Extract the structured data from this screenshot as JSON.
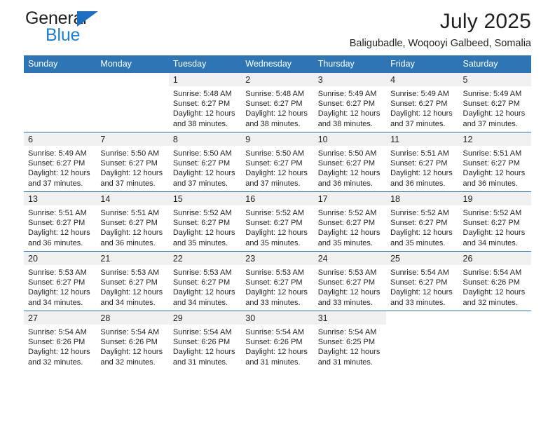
{
  "brand": {
    "name_part1": "General",
    "name_part2": "Blue",
    "triangle_color": "#1b6ec2",
    "blue_color": "#1b7fd4"
  },
  "header": {
    "title": "July 2025",
    "subtitle": "Baligubadle, Woqooyi Galbeed, Somalia",
    "header_bg": "#2e75b6",
    "daynum_bg": "#f0f0f0"
  },
  "weekdays": [
    "Sunday",
    "Monday",
    "Tuesday",
    "Wednesday",
    "Thursday",
    "Friday",
    "Saturday"
  ],
  "weeks": [
    [
      {
        "day": "",
        "blank": true,
        "lines": []
      },
      {
        "day": "",
        "blank": true,
        "lines": []
      },
      {
        "day": "1",
        "lines": [
          "Sunrise: 5:48 AM",
          "Sunset: 6:27 PM",
          "Daylight: 12 hours",
          "and 38 minutes."
        ]
      },
      {
        "day": "2",
        "lines": [
          "Sunrise: 5:48 AM",
          "Sunset: 6:27 PM",
          "Daylight: 12 hours",
          "and 38 minutes."
        ]
      },
      {
        "day": "3",
        "lines": [
          "Sunrise: 5:49 AM",
          "Sunset: 6:27 PM",
          "Daylight: 12 hours",
          "and 38 minutes."
        ]
      },
      {
        "day": "4",
        "lines": [
          "Sunrise: 5:49 AM",
          "Sunset: 6:27 PM",
          "Daylight: 12 hours",
          "and 37 minutes."
        ]
      },
      {
        "day": "5",
        "lines": [
          "Sunrise: 5:49 AM",
          "Sunset: 6:27 PM",
          "Daylight: 12 hours",
          "and 37 minutes."
        ]
      }
    ],
    [
      {
        "day": "6",
        "lines": [
          "Sunrise: 5:49 AM",
          "Sunset: 6:27 PM",
          "Daylight: 12 hours",
          "and 37 minutes."
        ]
      },
      {
        "day": "7",
        "lines": [
          "Sunrise: 5:50 AM",
          "Sunset: 6:27 PM",
          "Daylight: 12 hours",
          "and 37 minutes."
        ]
      },
      {
        "day": "8",
        "lines": [
          "Sunrise: 5:50 AM",
          "Sunset: 6:27 PM",
          "Daylight: 12 hours",
          "and 37 minutes."
        ]
      },
      {
        "day": "9",
        "lines": [
          "Sunrise: 5:50 AM",
          "Sunset: 6:27 PM",
          "Daylight: 12 hours",
          "and 37 minutes."
        ]
      },
      {
        "day": "10",
        "lines": [
          "Sunrise: 5:50 AM",
          "Sunset: 6:27 PM",
          "Daylight: 12 hours",
          "and 36 minutes."
        ]
      },
      {
        "day": "11",
        "lines": [
          "Sunrise: 5:51 AM",
          "Sunset: 6:27 PM",
          "Daylight: 12 hours",
          "and 36 minutes."
        ]
      },
      {
        "day": "12",
        "lines": [
          "Sunrise: 5:51 AM",
          "Sunset: 6:27 PM",
          "Daylight: 12 hours",
          "and 36 minutes."
        ]
      }
    ],
    [
      {
        "day": "13",
        "lines": [
          "Sunrise: 5:51 AM",
          "Sunset: 6:27 PM",
          "Daylight: 12 hours",
          "and 36 minutes."
        ]
      },
      {
        "day": "14",
        "lines": [
          "Sunrise: 5:51 AM",
          "Sunset: 6:27 PM",
          "Daylight: 12 hours",
          "and 36 minutes."
        ]
      },
      {
        "day": "15",
        "lines": [
          "Sunrise: 5:52 AM",
          "Sunset: 6:27 PM",
          "Daylight: 12 hours",
          "and 35 minutes."
        ]
      },
      {
        "day": "16",
        "lines": [
          "Sunrise: 5:52 AM",
          "Sunset: 6:27 PM",
          "Daylight: 12 hours",
          "and 35 minutes."
        ]
      },
      {
        "day": "17",
        "lines": [
          "Sunrise: 5:52 AM",
          "Sunset: 6:27 PM",
          "Daylight: 12 hours",
          "and 35 minutes."
        ]
      },
      {
        "day": "18",
        "lines": [
          "Sunrise: 5:52 AM",
          "Sunset: 6:27 PM",
          "Daylight: 12 hours",
          "and 35 minutes."
        ]
      },
      {
        "day": "19",
        "lines": [
          "Sunrise: 5:52 AM",
          "Sunset: 6:27 PM",
          "Daylight: 12 hours",
          "and 34 minutes."
        ]
      }
    ],
    [
      {
        "day": "20",
        "lines": [
          "Sunrise: 5:53 AM",
          "Sunset: 6:27 PM",
          "Daylight: 12 hours",
          "and 34 minutes."
        ]
      },
      {
        "day": "21",
        "lines": [
          "Sunrise: 5:53 AM",
          "Sunset: 6:27 PM",
          "Daylight: 12 hours",
          "and 34 minutes."
        ]
      },
      {
        "day": "22",
        "lines": [
          "Sunrise: 5:53 AM",
          "Sunset: 6:27 PM",
          "Daylight: 12 hours",
          "and 34 minutes."
        ]
      },
      {
        "day": "23",
        "lines": [
          "Sunrise: 5:53 AM",
          "Sunset: 6:27 PM",
          "Daylight: 12 hours",
          "and 33 minutes."
        ]
      },
      {
        "day": "24",
        "lines": [
          "Sunrise: 5:53 AM",
          "Sunset: 6:27 PM",
          "Daylight: 12 hours",
          "and 33 minutes."
        ]
      },
      {
        "day": "25",
        "lines": [
          "Sunrise: 5:54 AM",
          "Sunset: 6:27 PM",
          "Daylight: 12 hours",
          "and 33 minutes."
        ]
      },
      {
        "day": "26",
        "lines": [
          "Sunrise: 5:54 AM",
          "Sunset: 6:26 PM",
          "Daylight: 12 hours",
          "and 32 minutes."
        ]
      }
    ],
    [
      {
        "day": "27",
        "lines": [
          "Sunrise: 5:54 AM",
          "Sunset: 6:26 PM",
          "Daylight: 12 hours",
          "and 32 minutes."
        ]
      },
      {
        "day": "28",
        "lines": [
          "Sunrise: 5:54 AM",
          "Sunset: 6:26 PM",
          "Daylight: 12 hours",
          "and 32 minutes."
        ]
      },
      {
        "day": "29",
        "lines": [
          "Sunrise: 5:54 AM",
          "Sunset: 6:26 PM",
          "Daylight: 12 hours",
          "and 31 minutes."
        ]
      },
      {
        "day": "30",
        "lines": [
          "Sunrise: 5:54 AM",
          "Sunset: 6:26 PM",
          "Daylight: 12 hours",
          "and 31 minutes."
        ]
      },
      {
        "day": "31",
        "lines": [
          "Sunrise: 5:54 AM",
          "Sunset: 6:25 PM",
          "Daylight: 12 hours",
          "and 31 minutes."
        ]
      },
      {
        "day": "",
        "blank": true,
        "lines": []
      },
      {
        "day": "",
        "blank": true,
        "lines": []
      }
    ]
  ]
}
